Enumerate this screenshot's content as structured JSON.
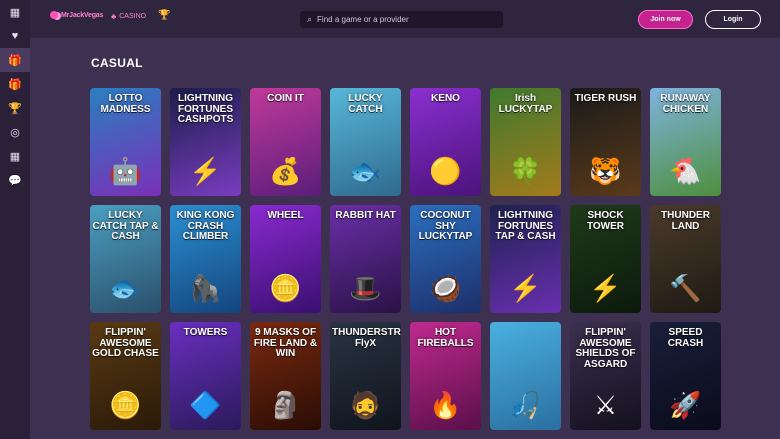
{
  "brand": {
    "name": "MrJackVegas"
  },
  "nav": {
    "casino_label": "CASINO"
  },
  "search": {
    "placeholder": "Find a game or a provider"
  },
  "auth": {
    "join_label": "Join now",
    "login_label": "Login"
  },
  "sidebar": {
    "items": [
      {
        "icon": "dashboard-icon",
        "glyph": "▦"
      },
      {
        "icon": "heart-icon",
        "glyph": "♥"
      },
      {
        "icon": "gift-icon",
        "glyph": "🎁",
        "active": true
      },
      {
        "icon": "gift-icon",
        "glyph": "🎁"
      },
      {
        "icon": "trophy-icon",
        "glyph": "🏆"
      },
      {
        "icon": "target-icon",
        "glyph": "◎"
      },
      {
        "icon": "dashboard-icon",
        "glyph": "▦"
      },
      {
        "icon": "chat-icon",
        "glyph": "💬"
      }
    ]
  },
  "section": {
    "title": "CASUAL"
  },
  "games": [
    {
      "title": "LOTTO MADNESS",
      "art": "🤖",
      "bg": "#2a7fc0",
      "bg2": "#7a2fb8"
    },
    {
      "title": "LIGHTNING FORTUNES CASHPOTS",
      "art": "⚡",
      "bg": "#1b1e4a",
      "bg2": "#7a3cc0"
    },
    {
      "title": "COIN IT",
      "art": "💰",
      "bg": "#c03a9a",
      "bg2": "#5a1d7a"
    },
    {
      "title": "LUCKY CATCH",
      "art": "🐟",
      "bg": "#58b7d8",
      "bg2": "#2f6a8e"
    },
    {
      "title": "KENO",
      "art": "🟡",
      "bg": "#8b2fd0",
      "bg2": "#4a137a"
    },
    {
      "title": "Irish LUCKYTAP",
      "art": "🍀",
      "bg": "#3f7a2e",
      "bg2": "#a37a1c"
    },
    {
      "title": "TIGER RUSH",
      "art": "🐯",
      "bg": "#1a1a1a",
      "bg2": "#5a3a1a"
    },
    {
      "title": "RUNAWAY CHICKEN",
      "art": "🐔",
      "bg": "#7fb3df",
      "bg2": "#4d8f3c"
    },
    {
      "title": "LUCKY CATCH TAP & CASH",
      "art": "🐟",
      "bg": "#4b9fc2",
      "bg2": "#2a4f6a"
    },
    {
      "title": "KING KONG CRASH CLIMBER",
      "art": "🦍",
      "bg": "#2c8fd1",
      "bg2": "#13457e"
    },
    {
      "title": "WHEEL",
      "art": "🪙",
      "bg": "#8a2ad0",
      "bg2": "#3a0f70"
    },
    {
      "title": "RABBIT HAT",
      "art": "🎩",
      "bg": "#6a2fa8",
      "bg2": "#2a1246"
    },
    {
      "title": "COCONUT SHY LUCKYTAP",
      "art": "🥥",
      "bg": "#2b6fbf",
      "bg2": "#1d2f6a"
    },
    {
      "title": "LIGHTNING FORTUNES TAP & CASH",
      "art": "⚡",
      "bg": "#1e2250",
      "bg2": "#6a2fb0"
    },
    {
      "title": "SHOCK TOWER",
      "art": "⚡",
      "bg": "#1f3a1a",
      "bg2": "#0c1a0c"
    },
    {
      "title": "THUNDER LAND",
      "art": "🔨",
      "bg": "#4a3b2a",
      "bg2": "#1f1a14"
    },
    {
      "title": "FLIPPIN' AWESOME GOLD CHASE",
      "art": "🪙",
      "bg": "#5a3a14",
      "bg2": "#2a1a08"
    },
    {
      "title": "TOWERS",
      "art": "🔷",
      "bg": "#6a2fc0",
      "bg2": "#2a1a5a"
    },
    {
      "title": "9 MASKS OF FIRE LAND & WIN",
      "art": "🗿",
      "bg": "#7a2a10",
      "bg2": "#2a0c04"
    },
    {
      "title": "THUNDERSTRUCK FlyX",
      "art": "🧔",
      "bg": "#2a3444",
      "bg2": "#0f141c"
    },
    {
      "title": "HOT FIREBALLS",
      "art": "🔥",
      "bg": "#c02a8f",
      "bg2": "#5a0f4a"
    },
    {
      "title": "",
      "art": "🎣",
      "bg": "#4ab0e0",
      "bg2": "#2a6fa0"
    },
    {
      "title": "FLIPPIN' AWESOME SHIELDS OF ASGARD",
      "art": "⚔",
      "bg": "#3a3050",
      "bg2": "#14101e"
    },
    {
      "title": "SPEED CRASH",
      "art": "🚀",
      "bg": "#1a1e3a",
      "bg2": "#0a0c1a"
    }
  ]
}
